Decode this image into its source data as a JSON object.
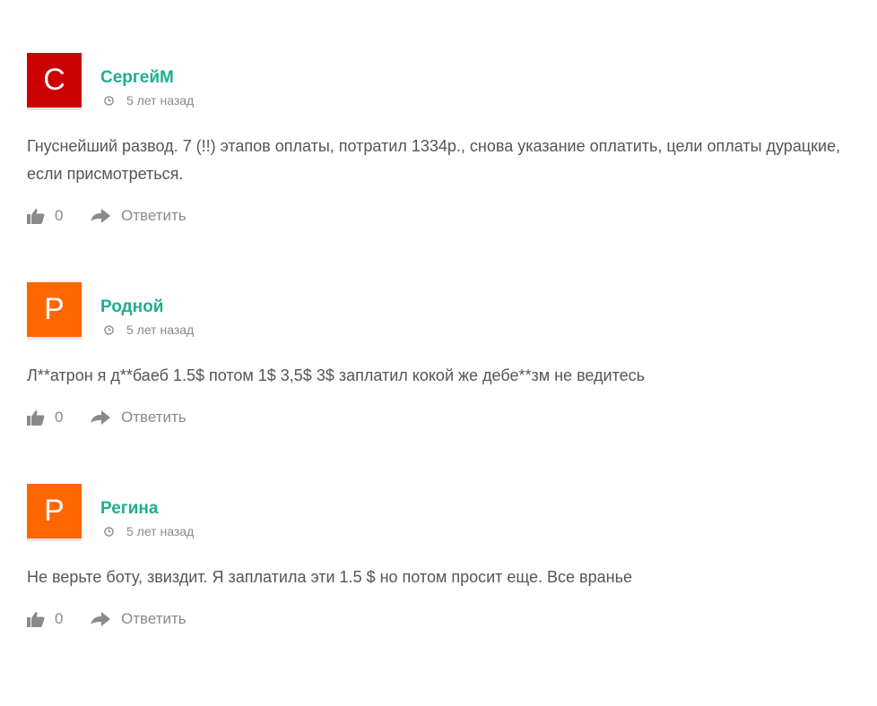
{
  "comments": [
    {
      "avatar_letter": "С",
      "avatar_color": "#cc0000",
      "author": "СергейМ",
      "date": "5 лет назад",
      "text": "Гнуснейший развод. 7 (!!) этапов оплаты, потратил 1334р., снова указание оплатить, цели оплаты дурацкие, если присмотреться.",
      "likes": "0",
      "reply_label": "Ответить"
    },
    {
      "avatar_letter": "Р",
      "avatar_color": "#ff6600",
      "author": "Родной",
      "date": "5 лет назад",
      "text": "Л**атрон я д**баеб 1.5$ потом 1$ 3,5$ 3$ заплатил кокой же дебе**зм не ведитесь",
      "likes": "0",
      "reply_label": "Ответить"
    },
    {
      "avatar_letter": "Р",
      "avatar_color": "#ff6600",
      "author": "Регина",
      "date": "5 лет назад",
      "text": "Не верьте боту, звиздит. Я заплатила эти 1.5 $ но потом просит еще. Все вранье",
      "likes": "0",
      "reply_label": "Ответить"
    }
  ],
  "colors": {
    "author": "#1fae8d",
    "text": "#555555",
    "meta": "#888888"
  },
  "icons": {
    "date": "clock-icon",
    "like": "thumbs-up-icon",
    "reply": "reply-arrow-icon"
  }
}
